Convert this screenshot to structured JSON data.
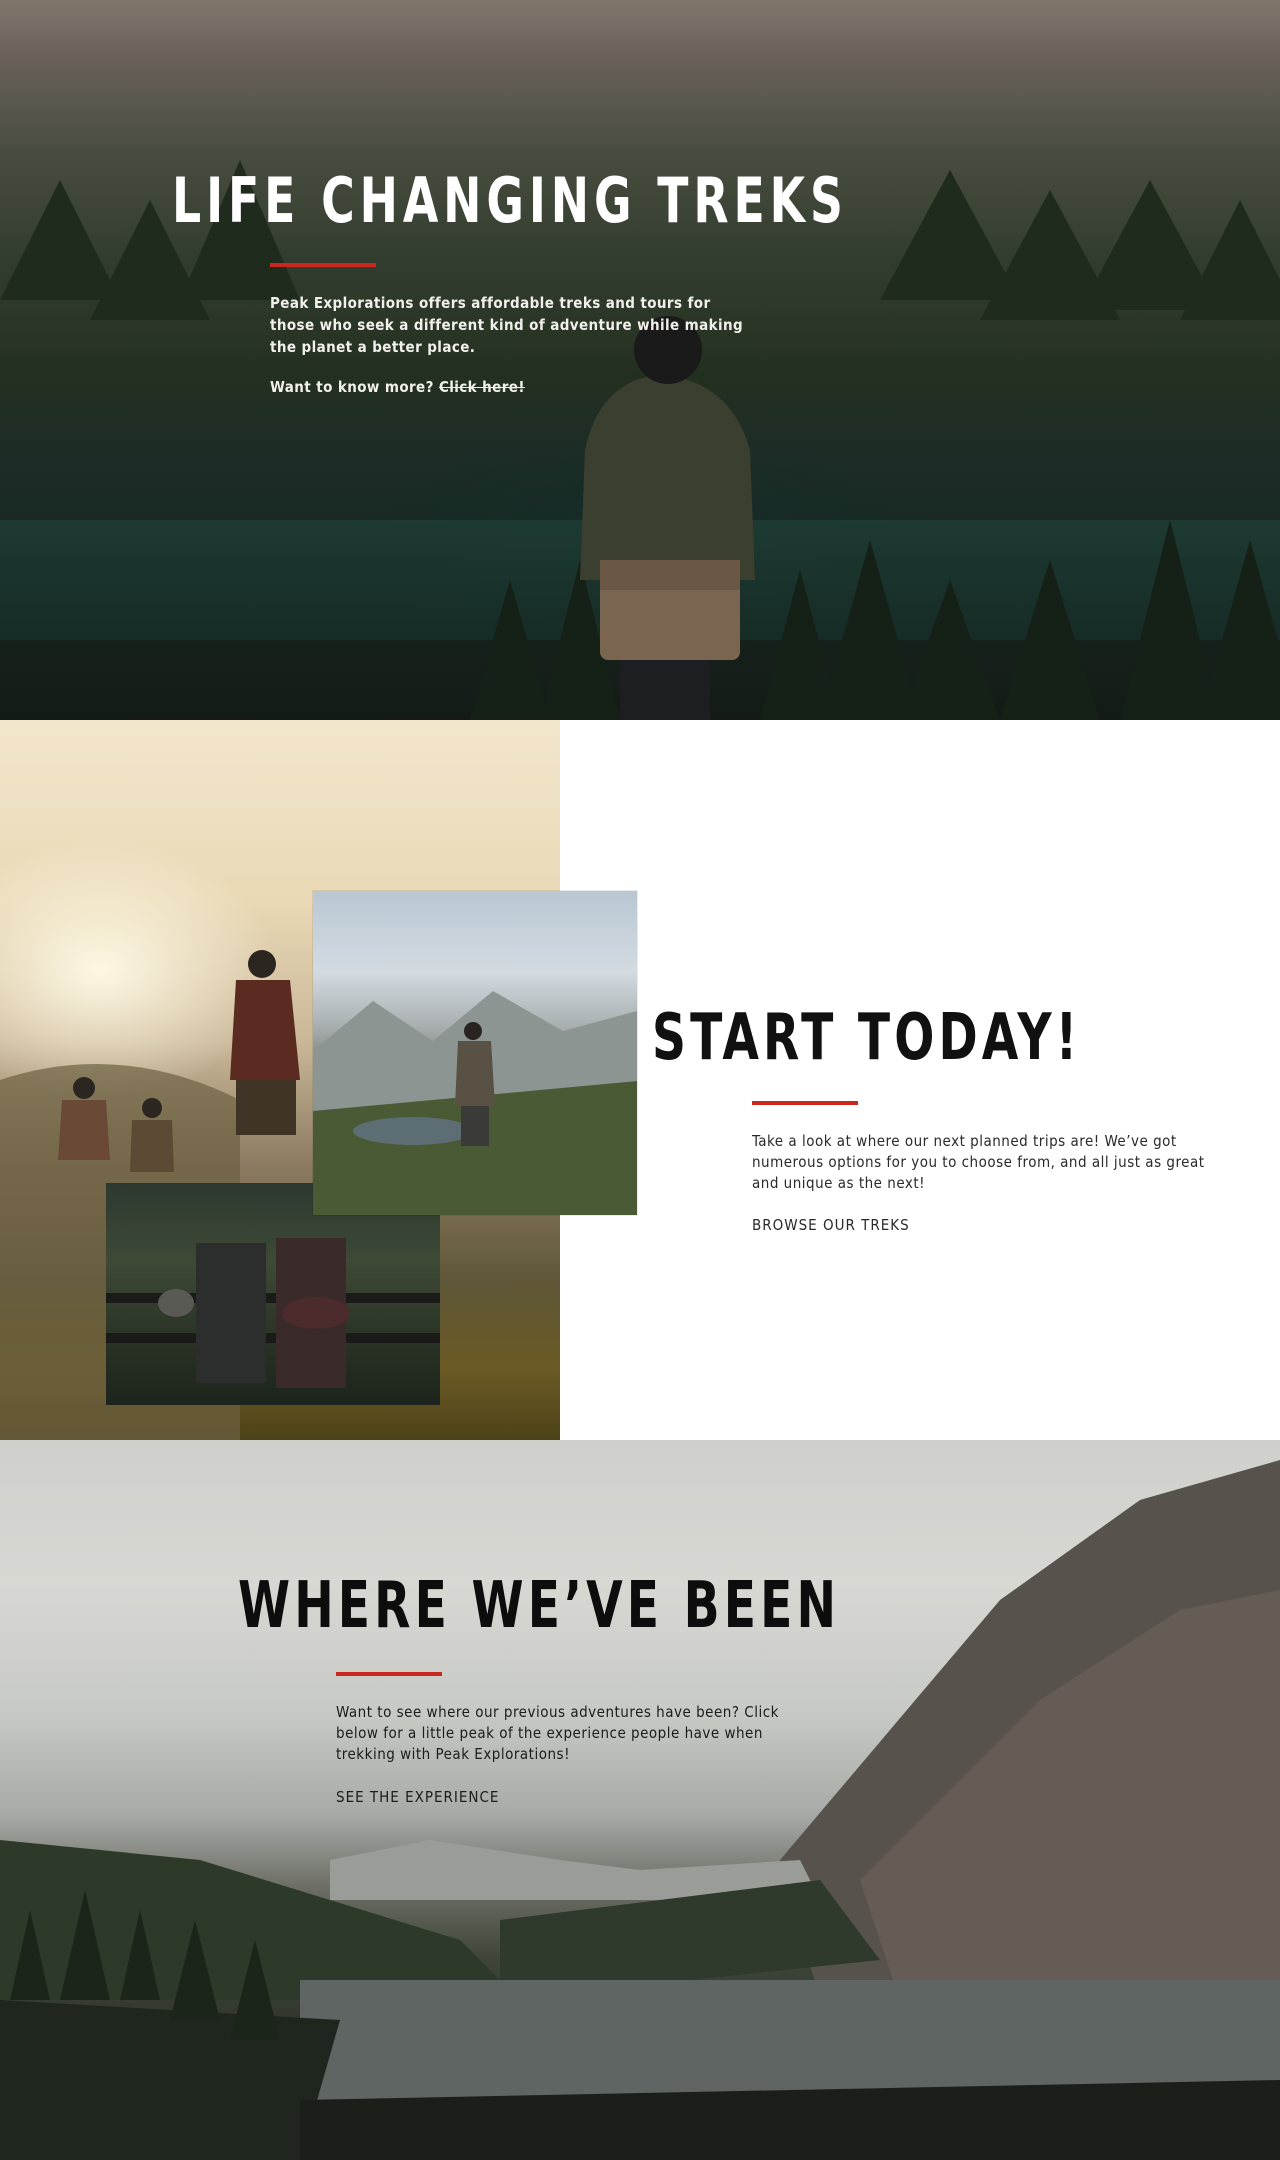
{
  "colors": {
    "accent": "#c8281d",
    "dark_text": "#111111",
    "white": "#ffffff"
  },
  "hero": {
    "title": "LIFE CHANGING TREKS",
    "description": "Peak Explorations offers affordable treks and tours for those who seek a different kind of adventure while making the planet a better place.",
    "more_prefix": "Want to know more? ",
    "more_link": "Click here!",
    "image_alt": "Hiker with backpack looking over forest lake"
  },
  "start": {
    "title": "START TODAY!",
    "description": "Take a look at where our next planned trips are! We’ve got numerous options for you to choose from, and all just as great and unique as the next!",
    "cta": "BROWSE OUR TREKS"
  },
  "been": {
    "title": "WHERE WE’VE BEEN",
    "description": "Want to see where our previous adventures have been? Click below for a little peak of the experience people have when trekking with Peak Explorations!",
    "cta": "SEE THE EXPERIENCE"
  }
}
